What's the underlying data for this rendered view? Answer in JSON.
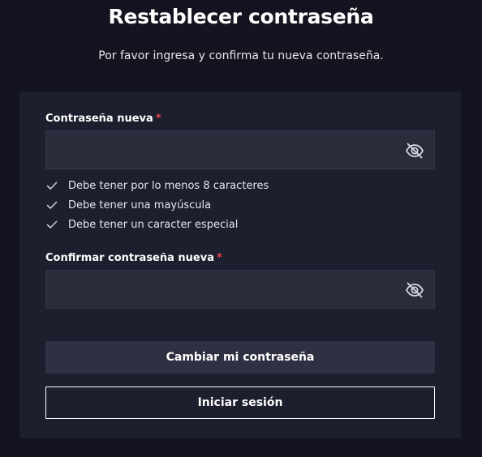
{
  "header": {
    "title": "Restablecer contraseña",
    "subtitle": "Por favor ingresa y confirma tu nueva contraseña."
  },
  "form": {
    "new_password": {
      "label": "Contraseña nueva",
      "required_marker": "*",
      "value": "",
      "icon": "eye-slash-icon"
    },
    "rules": [
      {
        "text": "Debe tener por lo menos 8 caracteres",
        "icon": "check-icon"
      },
      {
        "text": "Debe tener una mayúscula",
        "icon": "check-icon"
      },
      {
        "text": "Debe tener un caracter especial",
        "icon": "check-icon"
      }
    ],
    "confirm_password": {
      "label": "Confirmar contraseña nueva",
      "required_marker": "*",
      "value": "",
      "icon": "eye-slash-icon"
    },
    "submit_label": "Cambiar mi contraseña",
    "login_label": "Iniciar sesión"
  },
  "colors": {
    "background": "#13141f",
    "card": "#1d1e2e",
    "input": "#2a2b3b",
    "primary_button": "#2f3042",
    "required": "#e0454b"
  }
}
